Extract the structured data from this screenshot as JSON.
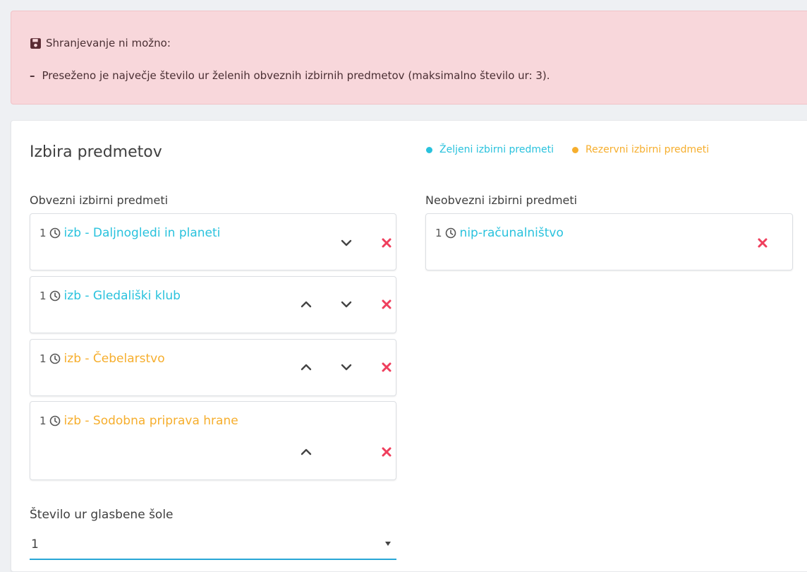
{
  "alert": {
    "title": "Shranjevanje ni možno:",
    "bullet": "–",
    "message": "Preseženo je največje število ur želenih obveznih izbirnih predmetov (maksimalno število ur: 3)."
  },
  "card": {
    "title": "Izbira predmetov",
    "legend": {
      "wanted": "Željeni izbirni predmeti",
      "reserve": "Rezervni izbirni predmeti"
    },
    "mandatory_label": "Obvezni izbirni predmeti",
    "optional_label": "Neobvezni izbirni predmeti",
    "mandatory_subjects": [
      {
        "hours": "1",
        "name": "izb - Daljnogledi in planeti",
        "color": "#29c2dd"
      },
      {
        "hours": "1",
        "name": "izb - Gledališki klub",
        "color": "#29c2dd"
      },
      {
        "hours": "1",
        "name": "izb - Čebelarstvo",
        "color": "#f6ae2d"
      },
      {
        "hours": "1",
        "name": "izb - Sodobna priprava hrane",
        "color": "#f6ae2d"
      }
    ],
    "optional_subjects": [
      {
        "hours": "1",
        "name": "nip-računalništvo",
        "color": "#29c2dd"
      }
    ],
    "music_school_label": "Število ur glasbene šole",
    "music_school_value": "1"
  },
  "colors": {
    "wanted": "#29c2dd",
    "reserve": "#f6ae2d",
    "remove": "#ef3e5c"
  }
}
